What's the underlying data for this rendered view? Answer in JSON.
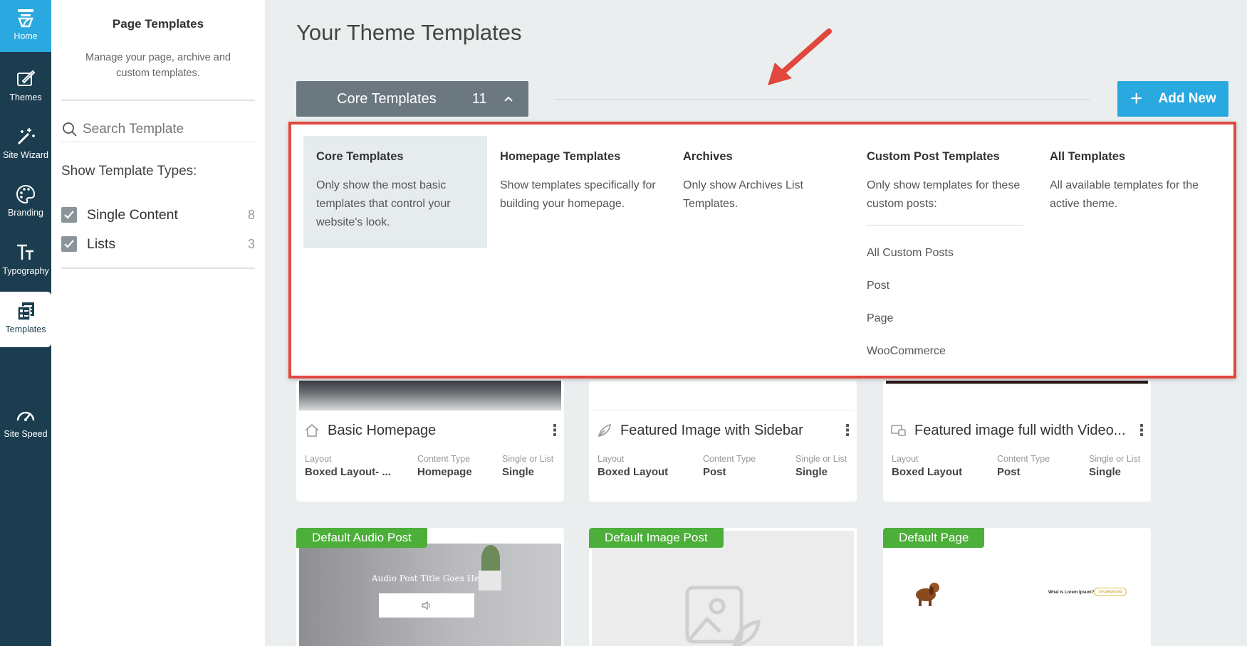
{
  "nav": {
    "items": [
      {
        "label": "Home",
        "icon": "home-icon"
      },
      {
        "label": "Themes",
        "icon": "themes-icon"
      },
      {
        "label": "Site Wizard",
        "icon": "magic-wand-icon"
      },
      {
        "label": "Branding",
        "icon": "palette-icon"
      },
      {
        "label": "Typography",
        "icon": "typography-icon"
      },
      {
        "label": "Templates",
        "icon": "templates-icon"
      },
      {
        "label": "Site Speed",
        "icon": "speedometer-icon"
      }
    ],
    "active": "Templates"
  },
  "panel": {
    "title": "Page Templates",
    "description": "Manage your page, archive and custom templates.",
    "search_placeholder": "Search Template",
    "types_label": "Show Template Types:",
    "types": [
      {
        "label": "Single Content",
        "count": "8",
        "checked": true
      },
      {
        "label": "Lists",
        "count": "3",
        "checked": true
      }
    ]
  },
  "main": {
    "title": "Your Theme Templates",
    "core_button": {
      "label": "Core Templates",
      "count": "11"
    },
    "add_new_label": "Add New"
  },
  "dropdown": {
    "columns": [
      {
        "title": "Core Templates",
        "desc": "Only show the most basic templates that control your website's look.",
        "selected": true
      },
      {
        "title": "Homepage Templates",
        "desc": "Show templates specifically for building your homepage."
      },
      {
        "title": "Archives",
        "desc": "Only show Archives List Templates."
      },
      {
        "title": "Custom Post Templates",
        "desc": "Only show templates for these custom posts:",
        "links": [
          "All Custom Posts",
          "Post",
          "Page",
          "WooCommerce"
        ]
      },
      {
        "title": "All Templates",
        "desc": "All available templates for the active theme."
      }
    ]
  },
  "cards": [
    {
      "title": "Basic Homepage",
      "icon": "home-outline-icon",
      "layout_label": "Layout",
      "layout": "Boxed Layout- ...",
      "type_label": "Content Type",
      "type": "Homepage",
      "single_label": "Single or List",
      "single": "Single"
    },
    {
      "title": "Featured Image with Sidebar",
      "icon": "feather-icon",
      "layout_label": "Layout",
      "layout": "Boxed Layout",
      "type_label": "Content Type",
      "type": "Post",
      "single_label": "Single or List",
      "single": "Single"
    },
    {
      "title": "Featured image full width Video...",
      "icon": "video-icon",
      "layout_label": "Layout",
      "layout": "Boxed Layout",
      "type_label": "Content Type",
      "type": "Post",
      "single_label": "Single or List",
      "single": "Single"
    }
  ],
  "bottom_cards": [
    {
      "badge": "Default Audio Post",
      "preview_text": "Audio Post Title Goes Here"
    },
    {
      "badge": "Default Image Post"
    },
    {
      "badge": "Default Page",
      "preview_text": "What Is Lorem Ipsum?",
      "preview_tag": "Uncategorized"
    }
  ],
  "colors": {
    "nav_bg": "#1b3d4f",
    "accent": "#2aa8e0",
    "badge_green": "#4caf3a",
    "annotation_red": "#e1483d"
  }
}
